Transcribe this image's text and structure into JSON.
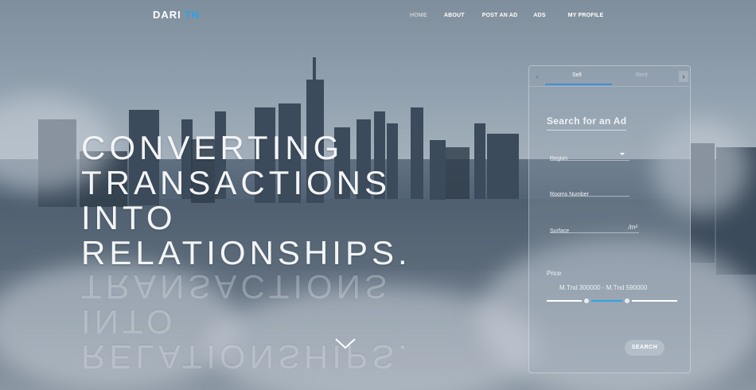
{
  "nav": {
    "logo_main": "DARI",
    "logo_accent": "TN",
    "links": [
      {
        "label": "HOME"
      },
      {
        "label": "ABOUT"
      },
      {
        "label": "POST AN AD"
      },
      {
        "label": "ADS"
      },
      {
        "label": "MY PROFILE"
      }
    ]
  },
  "hero": {
    "lines": [
      "CONVERTING",
      "TRANSACTIONS",
      "INTO",
      "RELATIONSHIPS."
    ]
  },
  "search_panel": {
    "tabs": [
      {
        "label": "Sell"
      },
      {
        "label": "Rent"
      }
    ],
    "active_tab": "Sell",
    "title": "Search for an Ad",
    "region_label": "Region",
    "rooms_label": "Rooms Number",
    "surface_label": "Surface",
    "surface_unit": "/m²",
    "price_label": "Price",
    "price_range": "M.Tnd 300000 - M.Tnd 590000",
    "price_min": 300000,
    "price_max": 590000,
    "search_button": "SEARCH"
  },
  "colors": {
    "accent": "#2aa4e8",
    "text": "#ffffff"
  },
  "icons": [
    "chevron-left-icon",
    "chevron-right-icon",
    "dropdown-caret-icon",
    "scroll-down-chevron-icon"
  ]
}
